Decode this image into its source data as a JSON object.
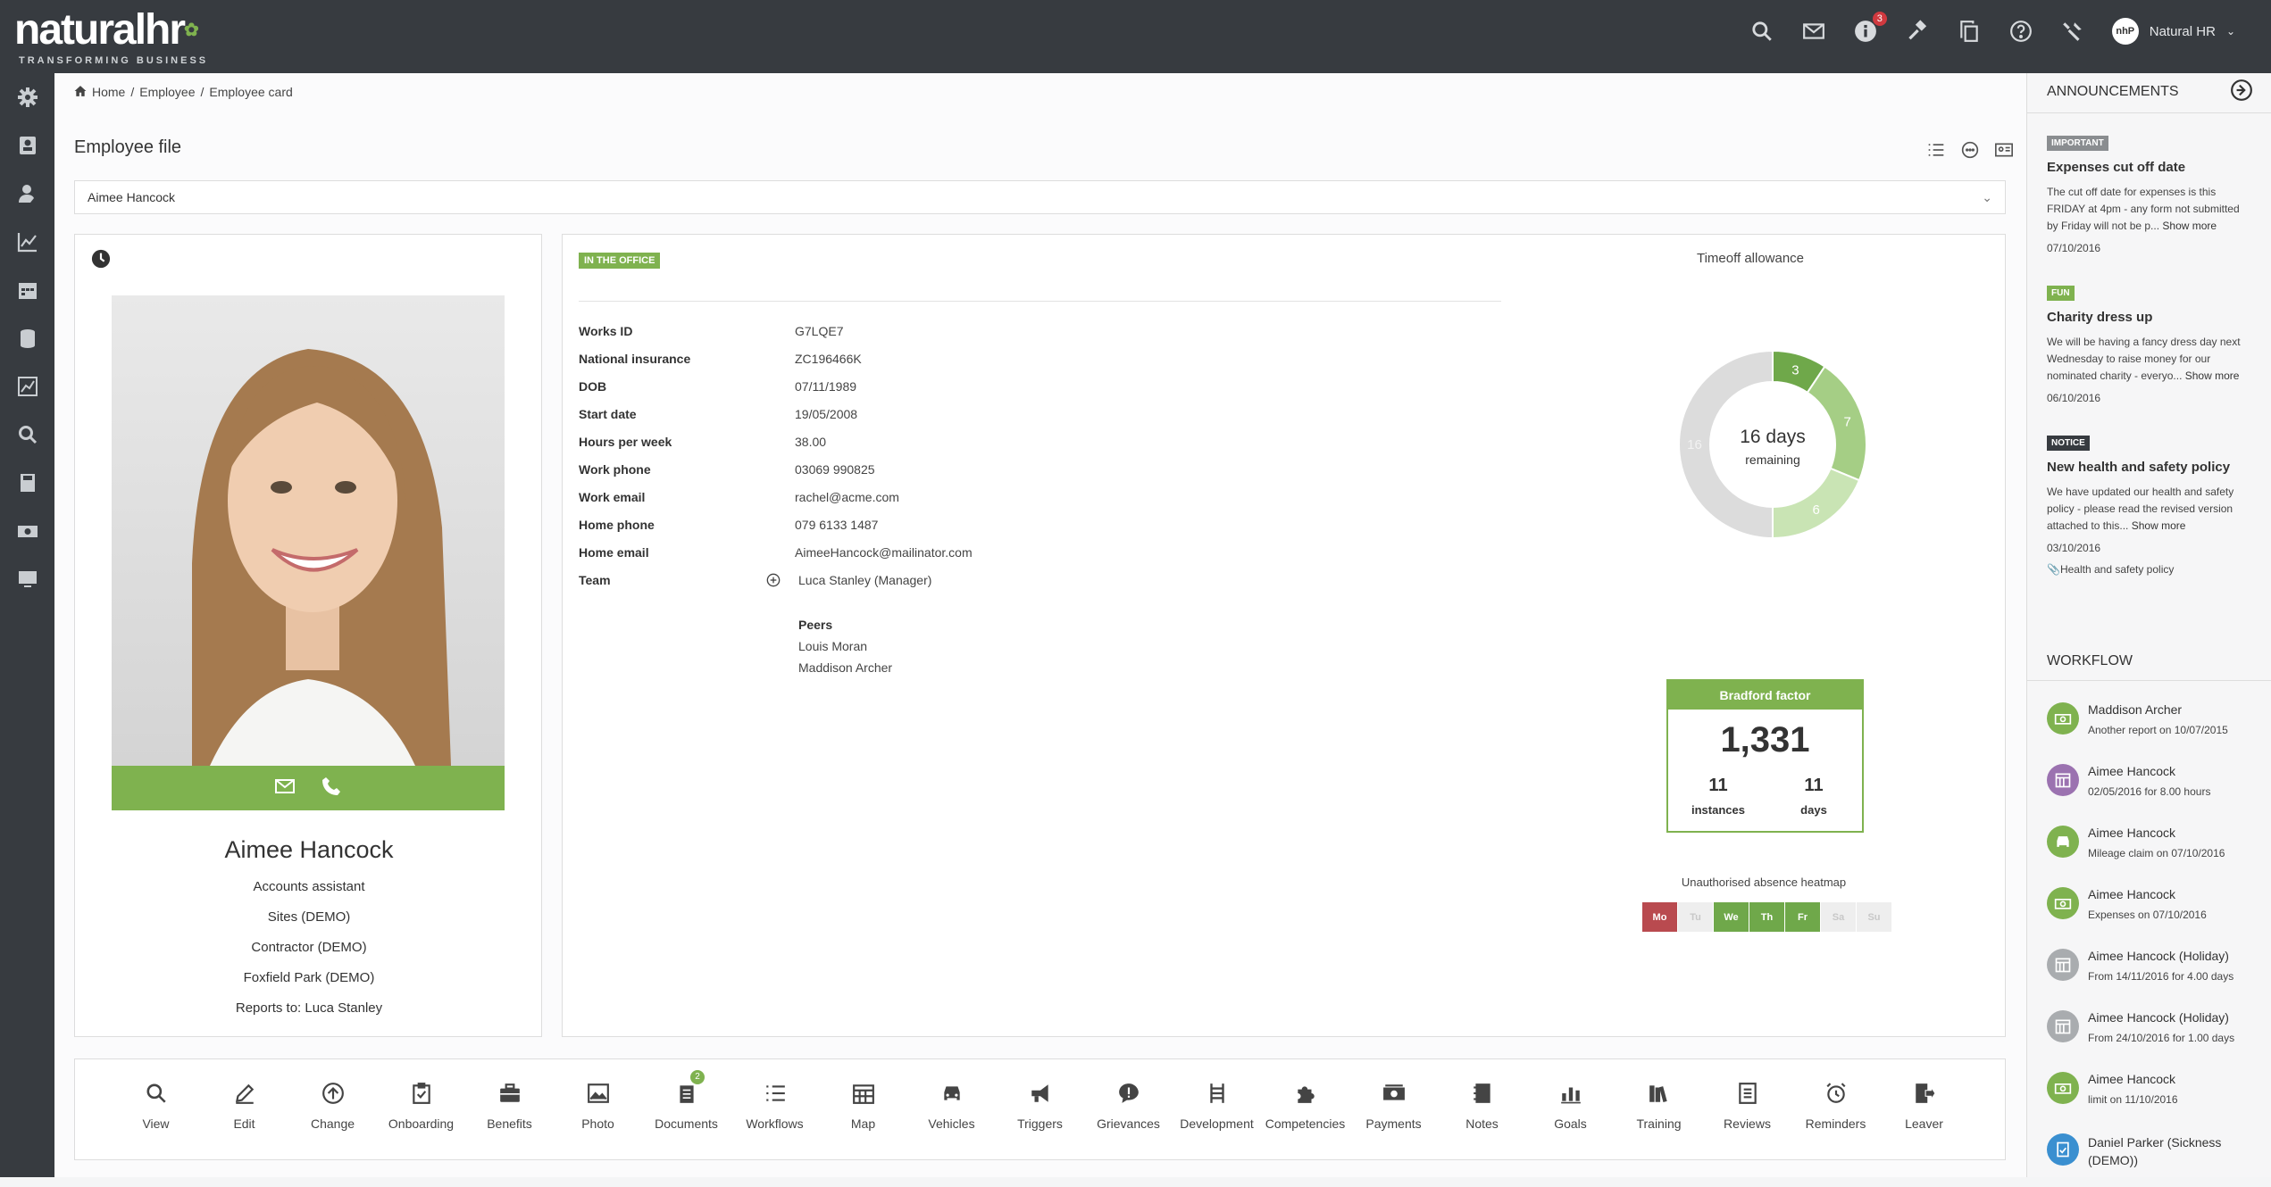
{
  "topbar": {
    "logo_word": "natural",
    "logo_word2": "hr",
    "logo_tagline": "TRANSFORMING BUSINESS",
    "alerts_badge": "3",
    "user_initials": "nhP",
    "user_name": "Natural HR",
    "icons": [
      "search-icon",
      "mail-icon",
      "info-icon",
      "gavel-icon",
      "copy-icon",
      "help-icon",
      "tools-icon"
    ]
  },
  "sidebar": {
    "icons": [
      "settings-icon",
      "contacts-icon",
      "user-icon",
      "chart-icon",
      "calendar-icon",
      "database-icon",
      "report-icon",
      "search-icon",
      "book-icon",
      "money-icon",
      "monitor-icon"
    ]
  },
  "breadcrumb": {
    "home": "Home",
    "sep1": "/",
    "employee": "Employee",
    "sep2": "/",
    "current": "Employee card"
  },
  "page": {
    "title": "Employee file",
    "selected_employee": "Aimee Hancock"
  },
  "profile": {
    "name": "Aimee Hancock",
    "role": "Accounts assistant",
    "site": "Sites (DEMO)",
    "contract": "Contractor (DEMO)",
    "location": "Foxfield Park (DEMO)",
    "reports_to": "Reports to: Luca Stanley"
  },
  "details": {
    "status": "IN THE OFFICE",
    "rows": [
      {
        "label": "Works ID",
        "value": "G7LQE7"
      },
      {
        "label": "National insurance",
        "value": "ZC196466K"
      },
      {
        "label": "DOB",
        "value": "07/11/1989"
      },
      {
        "label": "Start date",
        "value": "19/05/2008"
      },
      {
        "label": "Hours per week",
        "value": "38.00"
      },
      {
        "label": "Work phone",
        "value": "03069 990825"
      },
      {
        "label": "Work email",
        "value": "rachel@acme.com"
      },
      {
        "label": "Home phone",
        "value": "079 6133 1487"
      },
      {
        "label": "Home email",
        "value": "AimeeHancock@mailinator.com"
      }
    ],
    "team_label": "Team",
    "team_manager": "Luca Stanley (Manager)",
    "peers_title": "Peers",
    "peers": [
      "Louis Moran",
      "Maddison Archer"
    ]
  },
  "timeoff": {
    "title": "Timeoff allowance",
    "center_value": "16 days",
    "center_label": "remaining",
    "segments": [
      {
        "value": 3,
        "color": "#6fa84a"
      },
      {
        "value": 7,
        "color": "#a5ce85"
      },
      {
        "value": 6,
        "color": "#c9e4b4"
      },
      {
        "value": 16,
        "color": "#dcdcdc"
      }
    ]
  },
  "bradford": {
    "title": "Bradford factor",
    "score": "1,331",
    "instances_value": "11",
    "instances_label": "instances",
    "days_value": "11",
    "days_label": "days"
  },
  "heatmap": {
    "title": "Unauthorised absence heatmap",
    "days": [
      {
        "label": "Mo",
        "color": "#b94a4f"
      },
      {
        "label": "Tu",
        "color": "#eeeeee"
      },
      {
        "label": "We",
        "color": "#6fa84a"
      },
      {
        "label": "Th",
        "color": "#6fa84a"
      },
      {
        "label": "Fr",
        "color": "#6fa84a"
      },
      {
        "label": "Sa",
        "color": "#eeeeee"
      },
      {
        "label": "Su",
        "color": "#eeeeee"
      }
    ]
  },
  "actions": [
    {
      "label": "View",
      "icon": "search-icon"
    },
    {
      "label": "Edit",
      "icon": "pencil-icon"
    },
    {
      "label": "Change",
      "icon": "arrow-up-circle-icon"
    },
    {
      "label": "Onboarding",
      "icon": "clipboard-check-icon"
    },
    {
      "label": "Benefits",
      "icon": "briefcase-icon"
    },
    {
      "label": "Photo",
      "icon": "image-icon"
    },
    {
      "label": "Documents",
      "icon": "documents-icon",
      "badge": "2"
    },
    {
      "label": "Workflows",
      "icon": "list-icon"
    },
    {
      "label": "Map",
      "icon": "calendar-grid-icon"
    },
    {
      "label": "Vehicles",
      "icon": "car-icon"
    },
    {
      "label": "Triggers",
      "icon": "megaphone-icon"
    },
    {
      "label": "Grievances",
      "icon": "alert-bubble-icon"
    },
    {
      "label": "Development",
      "icon": "ladder-icon"
    },
    {
      "label": "Competencies",
      "icon": "puzzle-icon"
    },
    {
      "label": "Payments",
      "icon": "money-icon"
    },
    {
      "label": "Notes",
      "icon": "notebook-icon"
    },
    {
      "label": "Goals",
      "icon": "bar-chart-icon"
    },
    {
      "label": "Training",
      "icon": "books-icon"
    },
    {
      "label": "Reviews",
      "icon": "document-lines-icon"
    },
    {
      "label": "Reminders",
      "icon": "alarm-icon"
    },
    {
      "label": "Leaver",
      "icon": "exit-icon"
    }
  ],
  "announcements": {
    "title": "ANNOUNCEMENTS",
    "items": [
      {
        "tag": "IMPORTANT",
        "tag_color": "#8a8d90",
        "title": "Expenses cut off date",
        "body": "The cut off date for expenses is this FRIDAY at 4pm - any form not submitted by Friday will not be p...",
        "more": "Show more",
        "date": "07/10/2016"
      },
      {
        "tag": "FUN",
        "tag_color": "#7fb24f",
        "title": "Charity dress up",
        "body": "We will be having a fancy dress day next Wednesday to raise money for our nominated charity - everyo...",
        "more": "Show more",
        "date": "06/10/2016"
      },
      {
        "tag": "NOTICE",
        "tag_color": "#373b40",
        "title": "New health and safety policy",
        "body": "We have updated our health and safety policy - please read the revised version attached to this...",
        "more": "Show more",
        "date": "03/10/2016",
        "attachment": "Health and safety policy"
      }
    ]
  },
  "workflow": {
    "title": "WORKFLOW",
    "items": [
      {
        "name": "Maddison Archer",
        "sub": "Another report on 10/07/2015",
        "icon_color": "#7fb24f",
        "icon": "money-icon"
      },
      {
        "name": "Aimee Hancock",
        "sub": "02/05/2016 for 8.00 hours",
        "icon_color": "#9b72b0",
        "icon": "calendar-icon"
      },
      {
        "name": "Aimee Hancock",
        "sub": "Mileage claim on 07/10/2016",
        "icon_color": "#7fb24f",
        "icon": "car-icon"
      },
      {
        "name": "Aimee Hancock",
        "sub": "Expenses on 07/10/2016",
        "icon_color": "#7fb24f",
        "icon": "money-icon"
      },
      {
        "name": "Aimee Hancock (Holiday)",
        "sub": "From 14/11/2016 for 4.00 days",
        "icon_color": "#a9acaf",
        "icon": "calendar-icon"
      },
      {
        "name": "Aimee Hancock (Holiday)",
        "sub": "From 24/10/2016 for 1.00 days",
        "icon_color": "#a9acaf",
        "icon": "calendar-icon"
      },
      {
        "name": "Aimee Hancock",
        "sub": "limit on 11/10/2016",
        "icon_color": "#7fb24f",
        "icon": "money-icon"
      },
      {
        "name": "Daniel Parker (Sickness (DEMO))",
        "sub": "",
        "icon_color": "#3a8fd0",
        "icon": "document-icon"
      }
    ]
  }
}
